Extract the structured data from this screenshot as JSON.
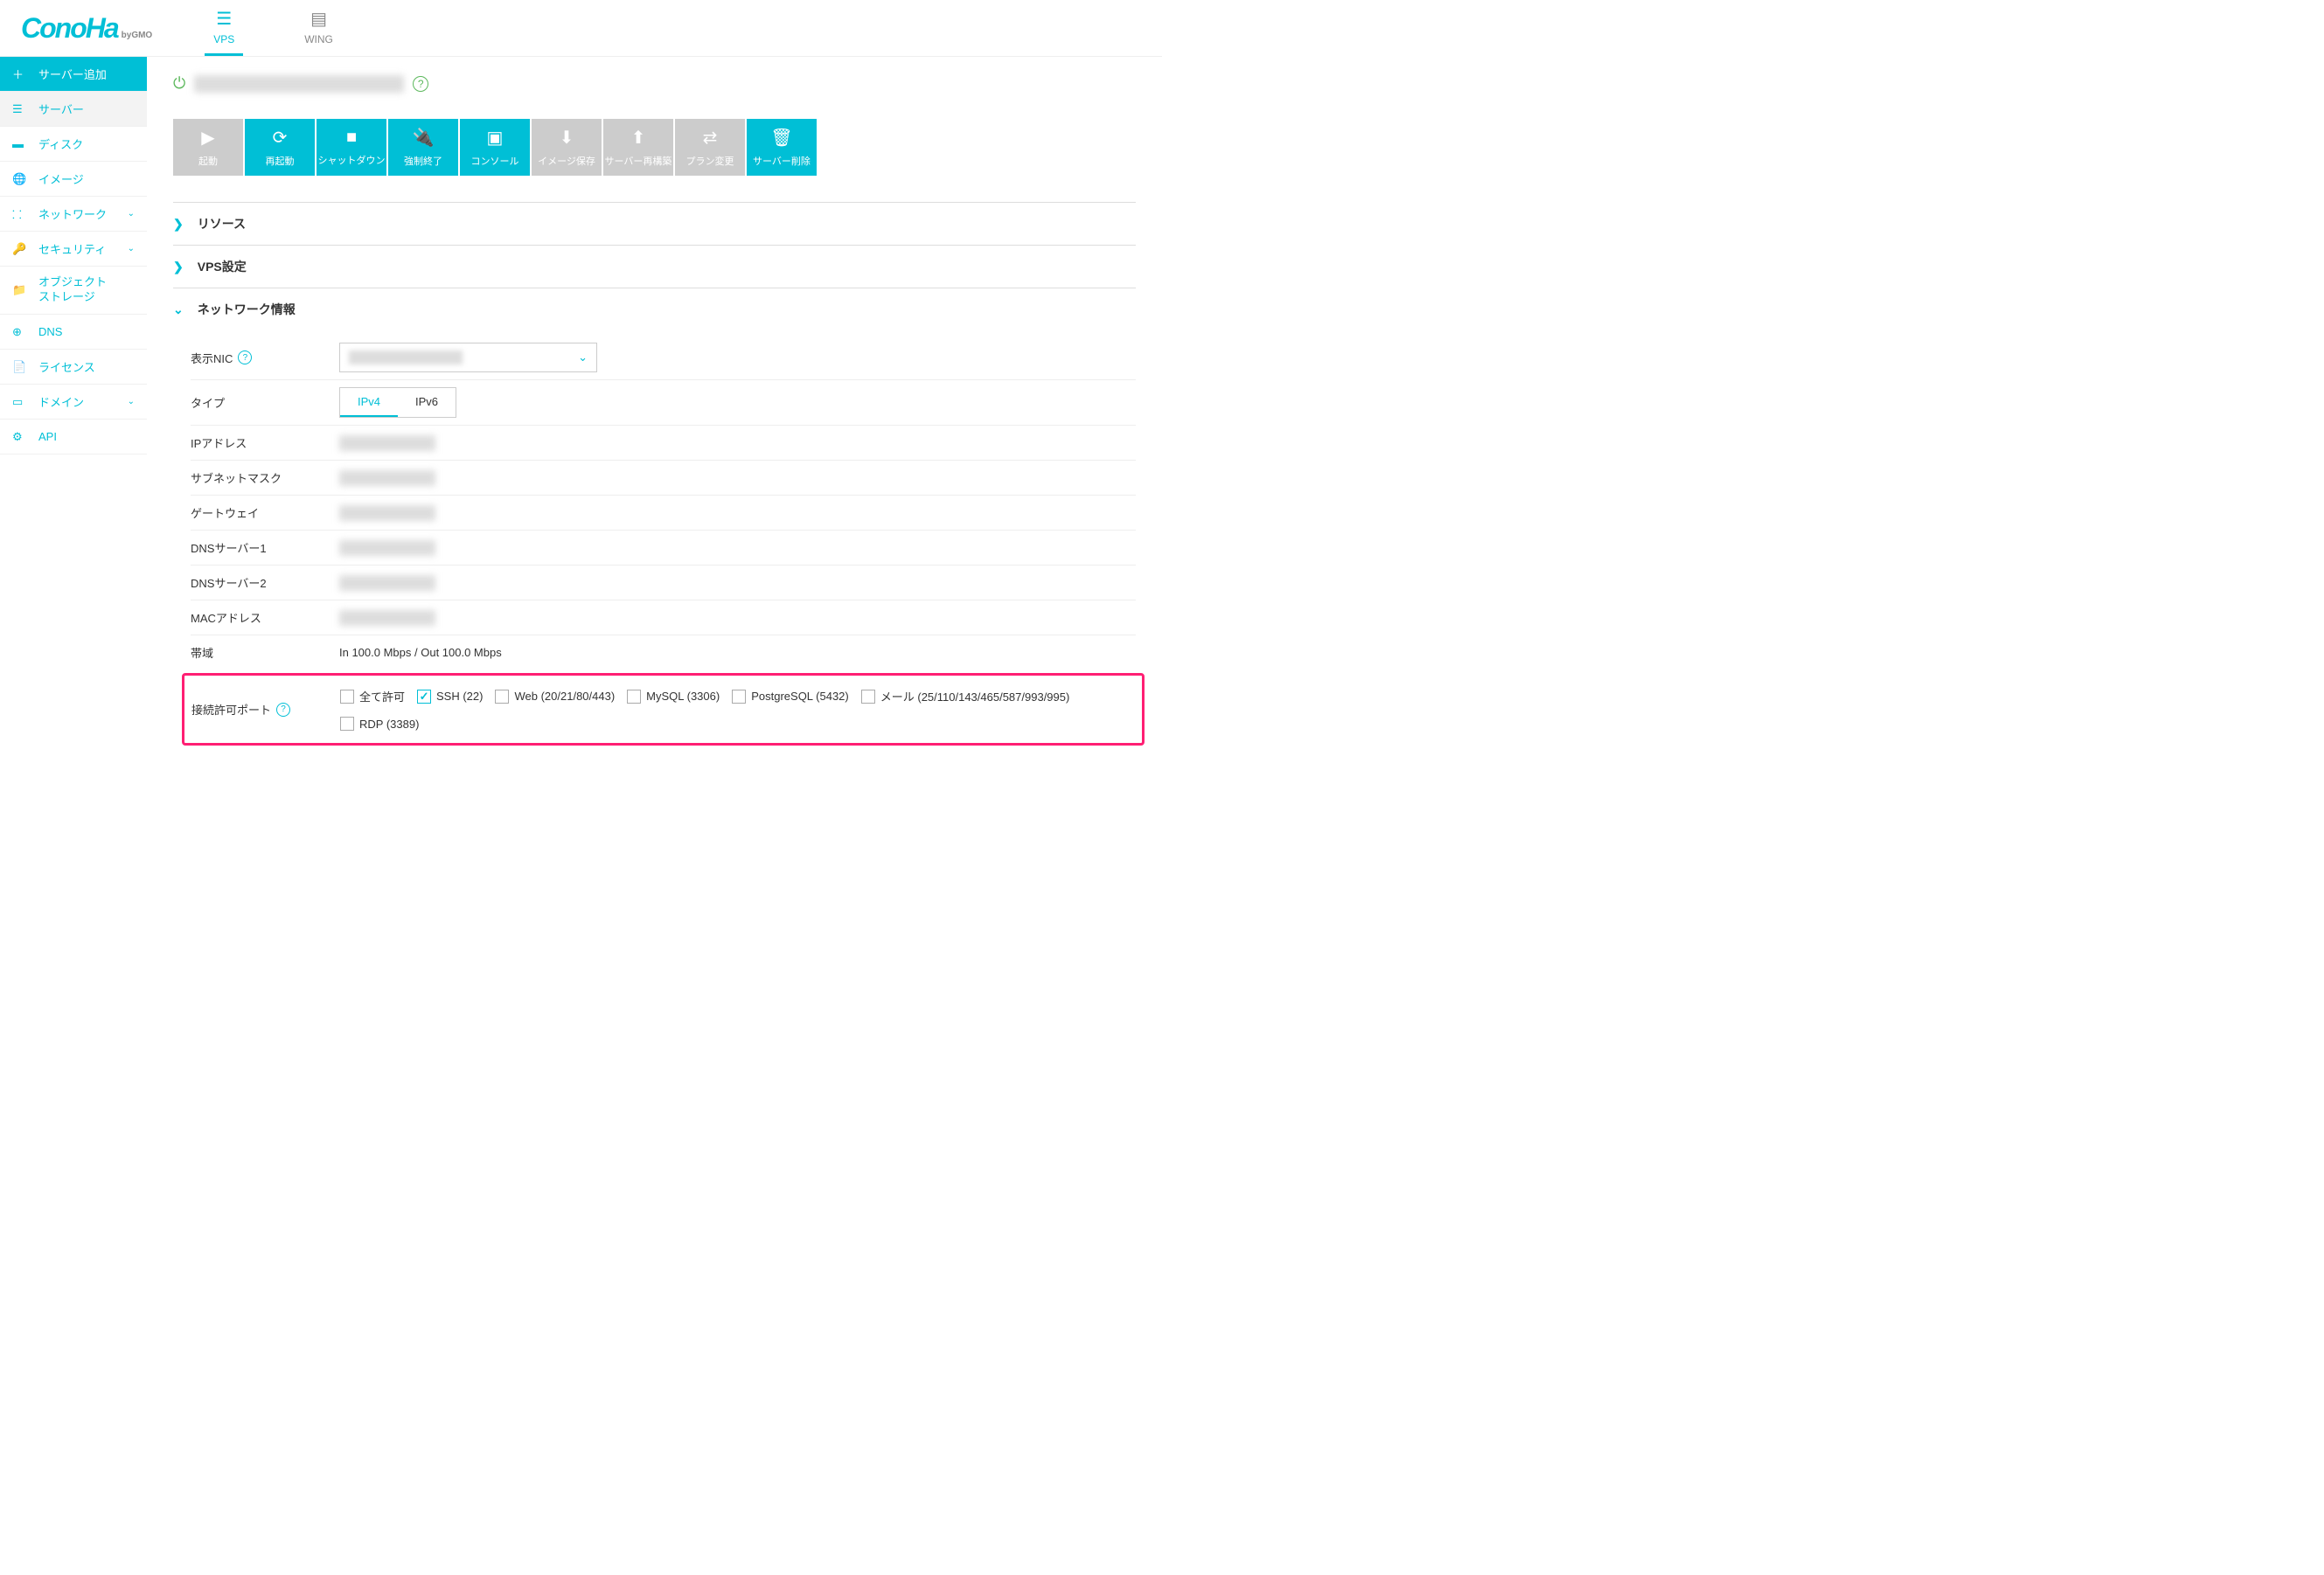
{
  "logo": "ConoHa",
  "logo_sub": "byGMO",
  "services": [
    {
      "label": "VPS",
      "icon": "server-icon",
      "active": true
    },
    {
      "label": "WING",
      "icon": "rack-icon",
      "active": false
    }
  ],
  "sidebar": [
    {
      "label": "サーバー追加",
      "kind": "add"
    },
    {
      "label": "サーバー",
      "kind": "active"
    },
    {
      "label": "ディスク"
    },
    {
      "label": "イメージ"
    },
    {
      "label": "ネットワーク",
      "chev": true
    },
    {
      "label": "セキュリティ",
      "chev": true
    },
    {
      "label": "オブジェクト",
      "label2": "ストレージ"
    },
    {
      "label": "DNS"
    },
    {
      "label": "ライセンス"
    },
    {
      "label": "ドメイン",
      "chev": true
    },
    {
      "label": "API"
    }
  ],
  "actions": [
    {
      "label": "起動",
      "disabled": true
    },
    {
      "label": "再起動"
    },
    {
      "label": "シャットダウン"
    },
    {
      "label": "強制終了"
    },
    {
      "label": "コンソール"
    },
    {
      "label": "イメージ保存",
      "disabled": true
    },
    {
      "label": "サーバー再構築",
      "disabled": true
    },
    {
      "label": "プラン変更",
      "disabled": true
    },
    {
      "label": "サーバー削除"
    }
  ],
  "action_icons": [
    "▶",
    "⟳",
    "■",
    "🔌",
    "▣",
    "⬇",
    "⬆",
    "⇄",
    "🗑"
  ],
  "sections": {
    "resource": "リソース",
    "vps": "VPS設定",
    "network": "ネットワーク情報"
  },
  "net": {
    "nic_label": "表示NIC",
    "type_label": "タイプ",
    "type_tabs": [
      "IPv4",
      "IPv6"
    ],
    "ip_label": "IPアドレス",
    "subnet_label": "サブネットマスク",
    "gateway_label": "ゲートウェイ",
    "dns1_label": "DNSサーバー1",
    "dns2_label": "DNSサーバー2",
    "mac_label": "MACアドレス",
    "band_label": "帯域",
    "band_value": "In 100.0 Mbps / Out 100.0 Mbps",
    "ports_label": "接続許可ポート",
    "port_options": [
      {
        "label": "全て許可",
        "checked": false
      },
      {
        "label": "SSH (22)",
        "checked": true
      },
      {
        "label": "Web (20/21/80/443)",
        "checked": false
      },
      {
        "label": "MySQL (3306)",
        "checked": false
      },
      {
        "label": "PostgreSQL (5432)",
        "checked": false
      },
      {
        "label": "メール (25/110/143/465/587/993/995)",
        "checked": false
      },
      {
        "label": "RDP (3389)",
        "checked": false
      }
    ]
  }
}
